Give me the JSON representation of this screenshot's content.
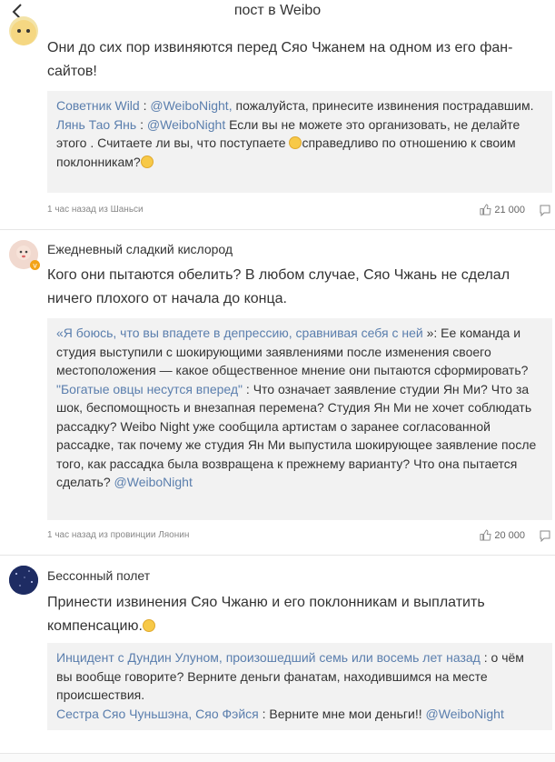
{
  "header": {
    "title": "пост в Weibo"
  },
  "posts": [
    {
      "author": "",
      "text": "Они до сих пор извиняются перед Сяо Чжанем на одном из его фан-сайтов!",
      "quotes": [
        {
          "name": "Советник Wild",
          "sep": " : ",
          "mention": "@WeiboNight,",
          "text": " пожалуйста, принесите извинения пострадавшим."
        },
        {
          "name": "Лянь Тао Янь",
          "sep": " : ",
          "mention": "@WeiboNight",
          "text": " Если вы не можете это организовать, не делайте этого . Считаете ли вы, что поступаете ",
          "text2": "справедливо по отношению к своим поклонникам?"
        }
      ],
      "meta": "1 час назад из Шаньси",
      "likes": "21 000"
    },
    {
      "author": "Ежедневный сладкий кислород",
      "text": "Кого они пытаются обелить? В любом случае, Сяо Чжань не сделал ничего плохого от начала до конца.",
      "quotes": [
        {
          "name": "«Я боюсь, что вы впадете в депрессию, сравнивая себя с ней",
          "sep": " »",
          "text": ": Ее команда и студия выступили с шокирующими заявлениями после изменения своего местоположения — какое общественное мнение они пытаются сформировать?"
        },
        {
          "name": "\"Богатые овцы несутся вперед\"",
          "sep": " : ",
          "text": "Что означает заявление студии Ян Ми? Что за шок, беспомощность и внезапная перемена? Студия Ян Ми не хочет соблюдать рассадку? Weibo Night уже сообщила артистам о заранее согласованной рассадке, так почему же студия Ян Ми выпустила шокирующее заявление после того, как рассадка была возвращена к прежнему варианту? Что она пытается сделать? ",
          "mention": "@WeiboNight"
        }
      ],
      "meta": "1 час назад из провинции Ляонин",
      "likes": "20 000"
    },
    {
      "author": "Бессонный полет",
      "text": "Принести извинения Сяо Чжаню и его поклонникам и выплатить компенсацию.",
      "quotes": [
        {
          "name": "Инцидент с Дундин Улуном, произошедший семь или восемь лет назад",
          "sep": " : ",
          "text": "о чём вы вообще говорите? Верните деньги фанатам, находившимся на месте происшествия."
        },
        {
          "name": "Сестра Сяо Чуньшэна, Сяо Фэйся",
          "sep": " : ",
          "text": "Верните мне мои деньги!! ",
          "mention": "@WeiboNight"
        }
      ]
    }
  ],
  "icons": {
    "back": "back-arrow-icon",
    "like": "thumbs-up-icon",
    "comment": "comment-icon",
    "emoji": "smile-emoji-icon"
  },
  "colors": {
    "link": "#5a7ead",
    "quote_bg": "#f2f2f2",
    "text": "#333333",
    "meta": "#888888"
  }
}
